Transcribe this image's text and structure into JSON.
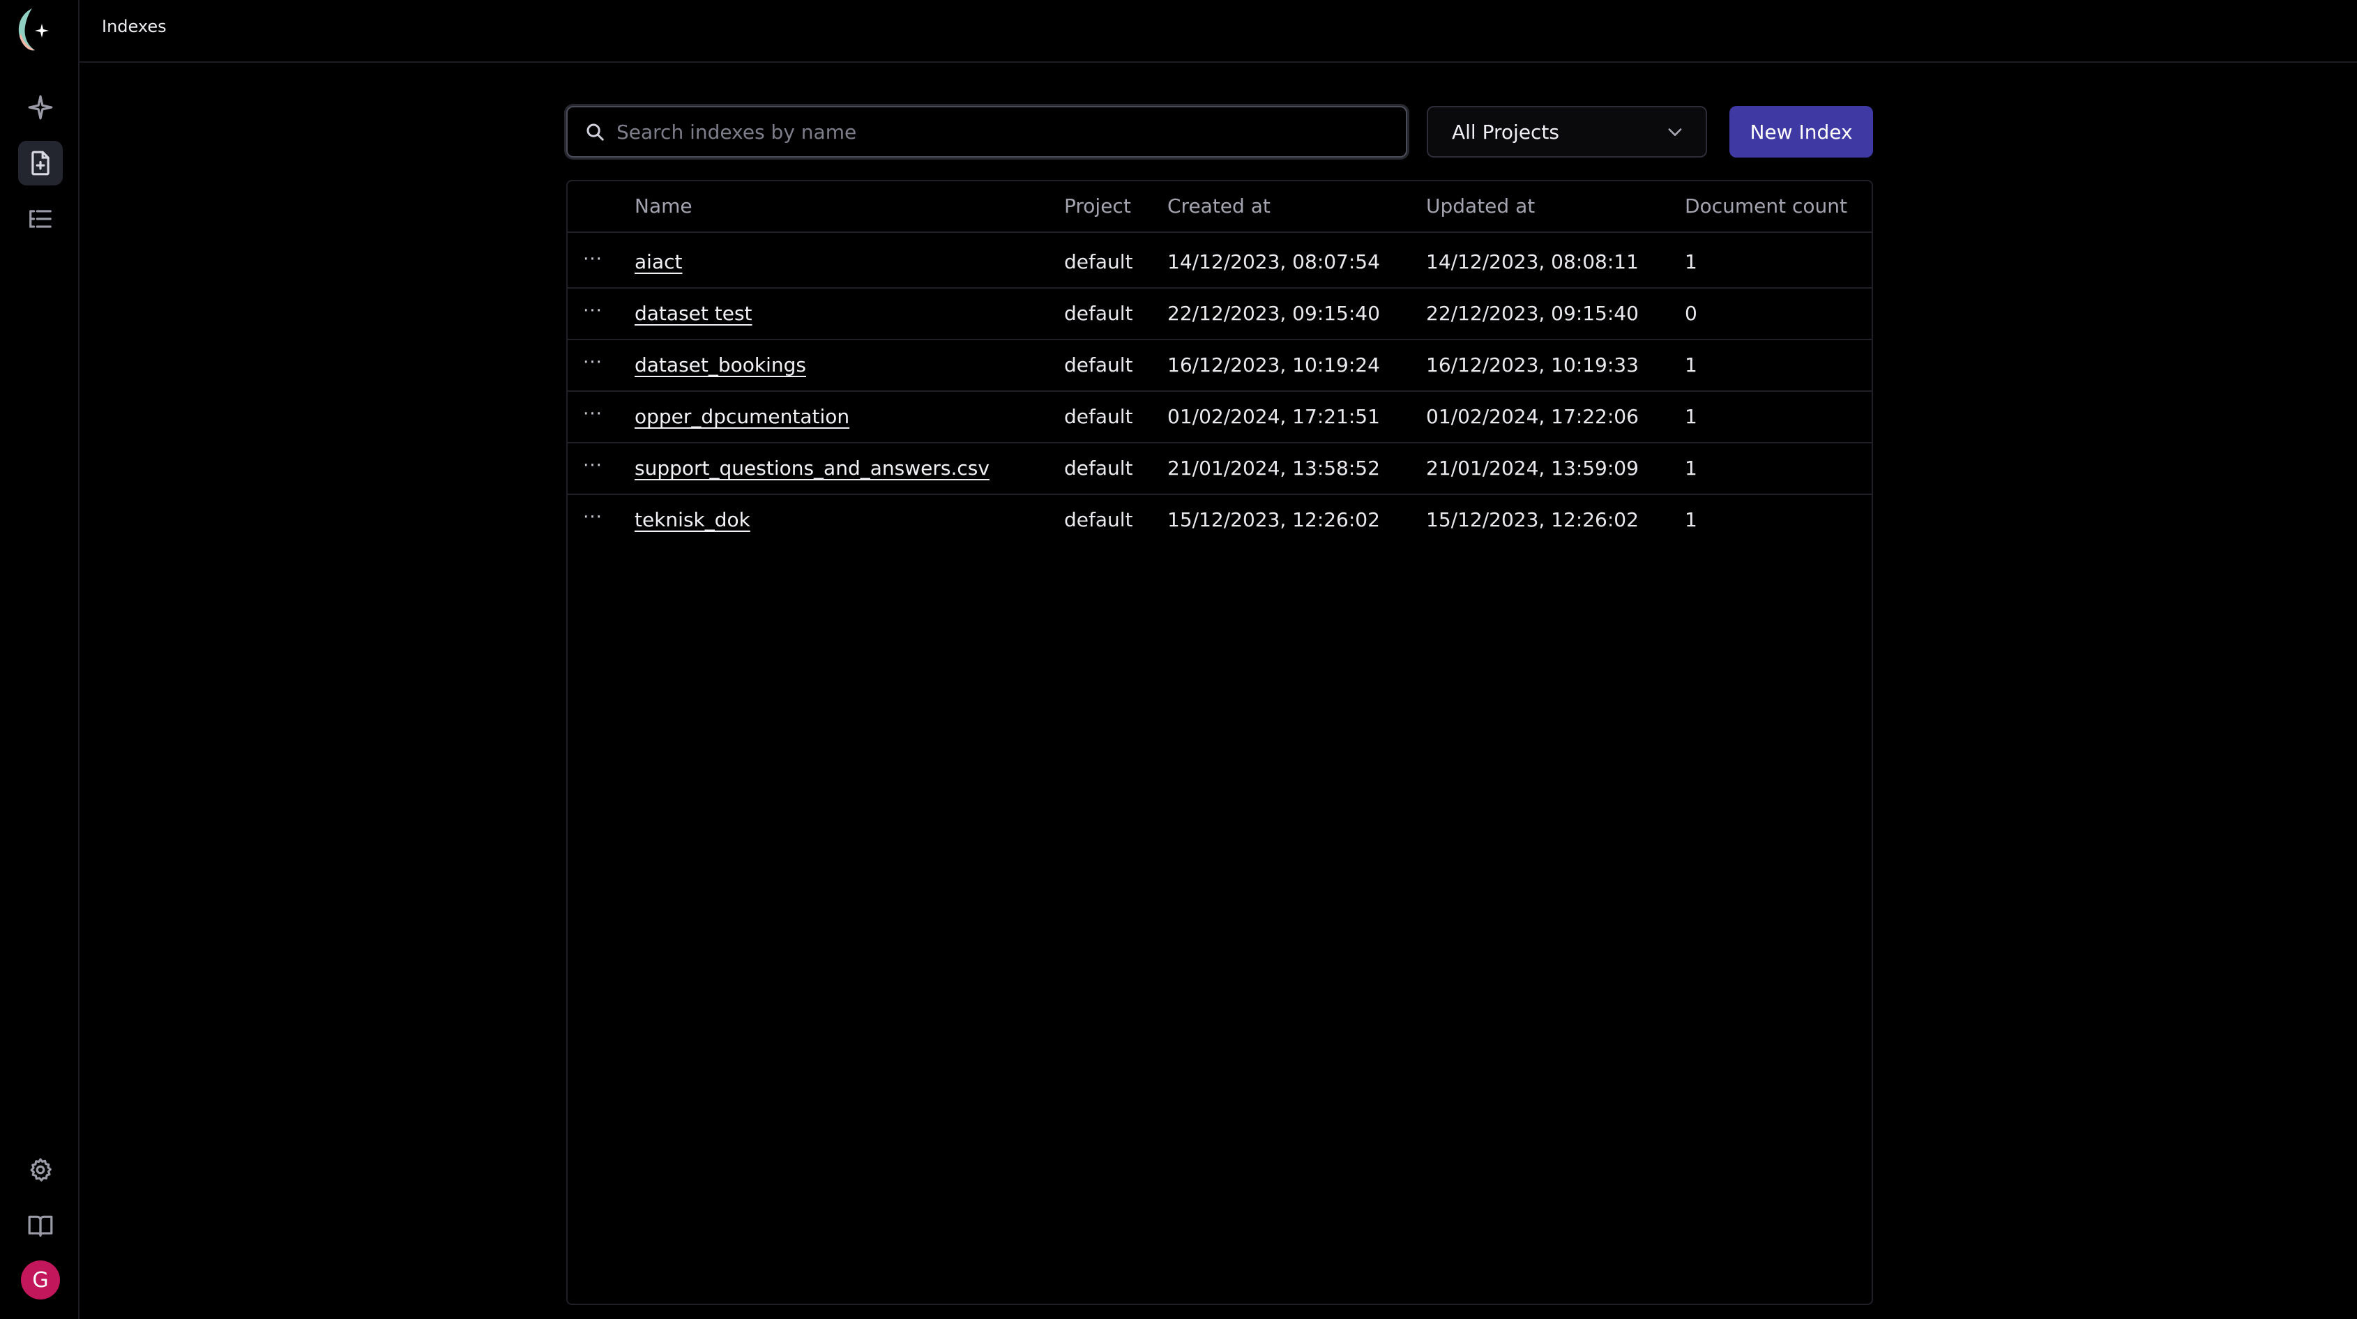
{
  "header": {
    "title": "Indexes"
  },
  "toolbar": {
    "search_placeholder": "Search indexes by name",
    "search_value": "",
    "project_filter": "All Projects",
    "new_button": "New Index"
  },
  "table": {
    "columns": [
      "Name",
      "Project",
      "Created at",
      "Updated at",
      "Document count"
    ],
    "row_menu_glyph": "···",
    "rows": [
      {
        "name": "aiact",
        "project": "default",
        "created": "14/12/2023, 08:07:54",
        "updated": "14/12/2023, 08:08:11",
        "count": "1"
      },
      {
        "name": "dataset test",
        "project": "default",
        "created": "22/12/2023, 09:15:40",
        "updated": "22/12/2023, 09:15:40",
        "count": "0"
      },
      {
        "name": "dataset_bookings",
        "project": "default",
        "created": "16/12/2023, 10:19:24",
        "updated": "16/12/2023, 10:19:33",
        "count": "1"
      },
      {
        "name": "opper_dpcumentation",
        "project": "default",
        "created": "01/02/2024, 17:21:51",
        "updated": "01/02/2024, 17:22:06",
        "count": "1"
      },
      {
        "name": "support_questions_and_answers.csv",
        "project": "default",
        "created": "21/01/2024, 13:58:52",
        "updated": "21/01/2024, 13:59:09",
        "count": "1"
      },
      {
        "name": "teknisk_dok",
        "project": "default",
        "created": "15/12/2023, 12:26:02",
        "updated": "15/12/2023, 12:26:02",
        "count": "1"
      }
    ]
  },
  "user": {
    "avatar_initial": "G"
  },
  "colors": {
    "background": "#000000",
    "accent": "#3f3aa3",
    "avatar": "#c2185b",
    "border": "#1f2028"
  },
  "icons": {
    "sidebar_top": [
      "sparkle-icon",
      "document-add-icon",
      "list-icon"
    ],
    "sidebar_bottom": [
      "gear-icon",
      "book-icon"
    ],
    "search": "search-icon",
    "dropdown": "chevron-down-icon"
  }
}
